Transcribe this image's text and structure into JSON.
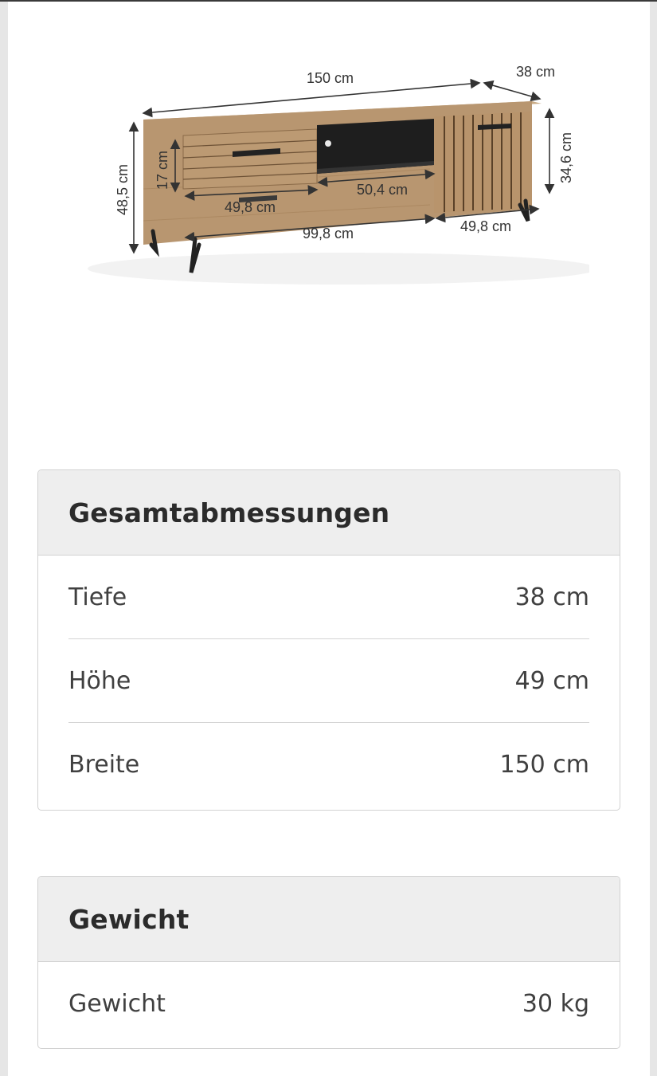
{
  "product_image": {
    "dimension_labels": {
      "total_width": "150 cm",
      "depth": "38 cm",
      "total_height": "48,5 cm",
      "drawer_height": "17 cm",
      "drawer_width": "49,8 cm",
      "shelf_width": "50,4 cm",
      "left_section_width": "99,8 cm",
      "door_width": "49,8 cm",
      "door_height": "34,6 cm"
    },
    "colors": {
      "wood": "#b89670",
      "metal": "#222222",
      "cavity": "#1e1e1e"
    }
  },
  "dimensions_card": {
    "title": "Gesamtabmessungen",
    "rows": [
      {
        "label": "Tiefe",
        "value": "38 cm"
      },
      {
        "label": "Höhe",
        "value": "49 cm"
      },
      {
        "label": "Breite",
        "value": "150 cm"
      }
    ]
  },
  "weight_card": {
    "title": "Gewicht",
    "rows": [
      {
        "label": "Gewicht",
        "value": "30 kg"
      }
    ]
  }
}
